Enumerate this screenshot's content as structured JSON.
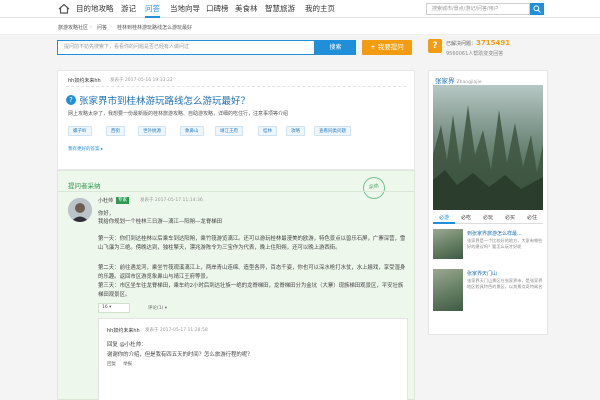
{
  "topnav": {
    "items": [
      "目的地攻略",
      "游记",
      "问答",
      "当地向导",
      "口碑榜",
      "美食林",
      "智慧旅游",
      "我的主页"
    ],
    "active_index": 2,
    "search_placeholder": "搜索城市/景点/游记/问答/用户"
  },
  "breadcrumb": [
    "旅游攻略社区",
    "问答",
    "桂林到桂林游玩路线怎么游玩最好"
  ],
  "askbar": {
    "placeholder": "提问前不妨先搜索下，看看你的问题是否已经有人做问过",
    "search_label": "搜索",
    "ask_label": "我要提问"
  },
  "stats": {
    "line1_prefix": "已解决问题：",
    "solved_count": "3715491",
    "line2": "9560061人帮助变变回答"
  },
  "question": {
    "user": "hh奴约未来hh",
    "time": "发表于 2017-05-16 19:33:22",
    "title": "张家界市到桂林游玩路线怎么游玩最好？",
    "desc": "网上攻略太杂了，我想要一份最新版的桂林旅游攻略、自助游攻略，详细的吃住行，注意事项等介绍",
    "tags": [
      "螺子岭",
      "西街",
      "世外桃源",
      "象鼻山",
      "靖江王府",
      "桂林",
      "攻略",
      "查看同类问题"
    ],
    "more_link": "我有更好的答案 ▸"
  },
  "answer": {
    "header": "提问者采纳",
    "stamp": "采纳",
    "user": "小杜帅",
    "level": "专家",
    "time": "发表于 2017-05-17 11:14:36",
    "greeting": "你好，",
    "intro": "我给你规划一个桂林三日游—漓江—阳朔—龙脊梯田",
    "day1": "第一天：你们到达桂林以后乘车到达阳朔，乘竹筏游览漓江。还可以游玩桂林最漫美的欧游，特色景点以兽乐石屏，广寨深营，雪山飞瀑为三绝。傍晚达到，独柱擎天，漂兆游陈令为三宝作为代表，晚上住阳朔，还可以晚上游西街。",
    "day2": "第二天：前往遇龙河，乘坐竹筏观溪漓江上，两岸青山连绵、造型各异，百态千姿，你也可以深水枪打水仗，水上嬉戏，享受湿身的乐趣。返回市区游览象鼻山与靖江王府等景。",
    "day3": "第三天：市区坐车往龙脊梯田，乘车约2小时后到达壮族一绝的龙脊梯田，龙脊梯田分为金坑（大寨）现族梯田观景区，平安壮族梯田观景区。",
    "vote": "16 ▾",
    "comment_link": "评论(1) ▾",
    "comment": {
      "user": "hh奴约未来hh",
      "time": "发表于 2017-05-17 11:28:58",
      "line1": "回复 @小杜帅：",
      "line2": "谢谢你的介绍，但是我有四五天的时间？怎么旅游行程的呢？",
      "reply": "回复",
      "report": "举报"
    }
  },
  "sidebar": {
    "title": "张家界",
    "subtitle": "Zhangjiajie",
    "tabs": [
      "必游",
      "必吃",
      "必玩",
      "必买",
      "必住"
    ],
    "items": [
      {
        "title": "到张家界旅游怎么样最...",
        "desc": "张家界是一个比较好的地方，大家有哪些好的建议吗？要怎么玩才好呢"
      },
      {
        "title": "张家界天门山",
        "desc": "张家界天门山景区在张家界市，是张家界地区较具特色的景区，以其景点奇特闻名"
      }
    ]
  }
}
